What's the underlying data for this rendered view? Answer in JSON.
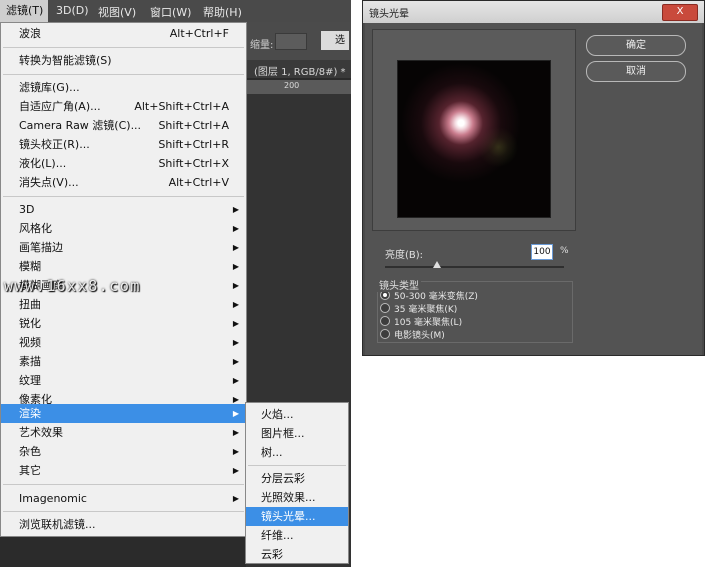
{
  "photoshop": {
    "menubar": [
      {
        "label": "滤镜(T)"
      },
      {
        "label": "3D(D)"
      },
      {
        "label": "视图(V)"
      },
      {
        "label": "窗口(W)"
      },
      {
        "label": "帮助(H)"
      }
    ],
    "options_bar": {
      "field_label": "缩量:",
      "button_label": "选"
    },
    "doc_tab": "(图层 1, RGB/8#) *",
    "ruler_label": "200",
    "filter_menu": [
      {
        "label": "波浪",
        "shortcut": "Alt+Ctrl+F"
      },
      {
        "label": "转换为智能滤镜(S)"
      },
      {
        "label": "滤镜库(G)..."
      },
      {
        "label": "自适应广角(A)...",
        "shortcut": "Alt+Shift+Ctrl+A"
      },
      {
        "label": "Camera Raw 滤镜(C)...",
        "shortcut": "Shift+Ctrl+A"
      },
      {
        "label": "镜头校正(R)...",
        "shortcut": "Shift+Ctrl+R"
      },
      {
        "label": "液化(L)...",
        "shortcut": "Shift+Ctrl+X"
      },
      {
        "label": "消失点(V)...",
        "shortcut": "Alt+Ctrl+V"
      },
      {
        "label": "3D"
      },
      {
        "label": "风格化"
      },
      {
        "label": "画笔描边"
      },
      {
        "label": "模糊"
      },
      {
        "label": "模糊画廊"
      },
      {
        "label": "扭曲"
      },
      {
        "label": "锐化"
      },
      {
        "label": "视频"
      },
      {
        "label": "素描"
      },
      {
        "label": "纹理"
      },
      {
        "label": "像素化"
      },
      {
        "label": "渲染"
      },
      {
        "label": "艺术效果"
      },
      {
        "label": "杂色"
      },
      {
        "label": "其它"
      },
      {
        "label": "Imagenomic"
      },
      {
        "label": "浏览联机滤镜..."
      }
    ],
    "render_submenu": [
      {
        "label": "火焰..."
      },
      {
        "label": "图片框..."
      },
      {
        "label": "树..."
      },
      {
        "label": "分层云彩"
      },
      {
        "label": "光照效果..."
      },
      {
        "label": "镜头光晕..."
      },
      {
        "label": "纤维..."
      },
      {
        "label": "云彩"
      }
    ],
    "watermark": "www.16xx8.com"
  },
  "dialog": {
    "title": "镜头光晕",
    "close_label": "X",
    "ok_label": "确定",
    "cancel_label": "取消",
    "brightness_label": "亮度(B):",
    "brightness_value": "100",
    "brightness_unit": "%",
    "brightness_slider_fraction": 0.29,
    "lens_type_title": "镜头类型",
    "lens_types": [
      {
        "label": "50-300 毫米变焦(Z)",
        "selected": true
      },
      {
        "label": "35 毫米聚焦(K)",
        "selected": false
      },
      {
        "label": "105 毫米聚焦(L)",
        "selected": false
      },
      {
        "label": "电影镜头(M)",
        "selected": false
      }
    ]
  },
  "colors": {
    "highlight": "#3c8fe6",
    "close_button": "#c94a3c"
  }
}
